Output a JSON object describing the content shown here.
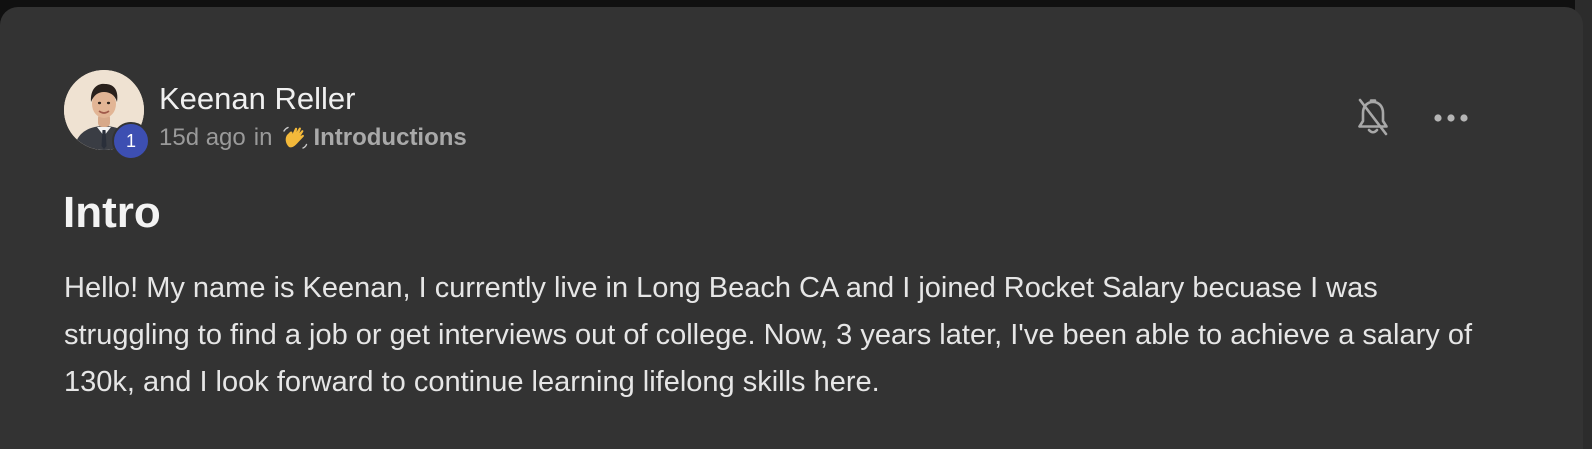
{
  "post": {
    "author": {
      "name": "Keenan Reller",
      "level": "1"
    },
    "meta": {
      "time_ago": "15d ago",
      "in_word": "in",
      "category_emoji": "waving-hand-icon",
      "category": "Introductions"
    },
    "title": "Intro",
    "body": "Hello! My name is Keenan, I currently live in Long Beach CA and I joined Rocket Salary becuase I was struggling to find a job or get interviews out of college. Now, 3 years later, I've been able to achieve a salary of 130k, and I look forward to continue learning lifelong skills here."
  },
  "actions": {
    "notification_icon": "bell-off-icon",
    "more_icon": "more-horizontal-icon"
  },
  "colors": {
    "card_background": "#333333",
    "page_background": "#101010",
    "level_badge": "#3d4fb2",
    "text_primary": "#f0f0f0",
    "text_muted": "#9a9a9a"
  }
}
